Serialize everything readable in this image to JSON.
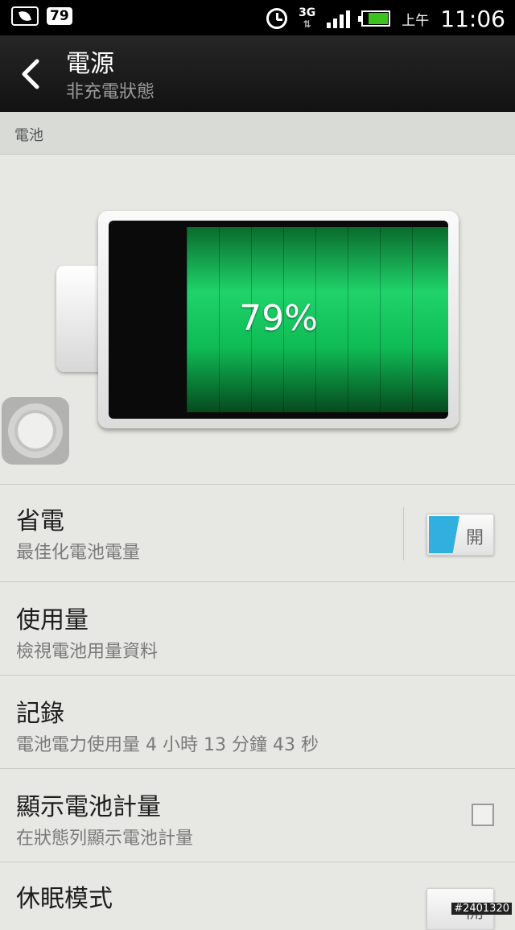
{
  "status_bar": {
    "notification_badge": "79",
    "network": "3G",
    "am_pm": "上午",
    "time": "11:06",
    "battery_level_fraction": 0.79,
    "battery_color": "#3bc31d"
  },
  "action_bar": {
    "title": "電源",
    "subtitle": "非充電狀態",
    "back_icon": "chevron-left-icon"
  },
  "section": {
    "header": "電池"
  },
  "battery": {
    "percent_text": "79%",
    "level_fraction": 0.79,
    "fill_color": "#1fd36a"
  },
  "settings": [
    {
      "title": "省電",
      "subtitle": "最佳化電池電量",
      "control": "toggle",
      "control_label": "開",
      "control_color": "#31b0e0"
    },
    {
      "title": "使用量",
      "subtitle": "檢視電池用量資料",
      "control": "none"
    },
    {
      "title": "記錄",
      "subtitle": "電池電力使用量 4 小時 13 分鐘 43 秒",
      "control": "none"
    },
    {
      "title": "顯示電池計量",
      "subtitle": "在狀態列顯示電池計量",
      "control": "checkbox",
      "checked": false
    },
    {
      "title": "休眠模式",
      "control": "toggle",
      "control_label": "開"
    }
  ],
  "watermark": "#2401320"
}
